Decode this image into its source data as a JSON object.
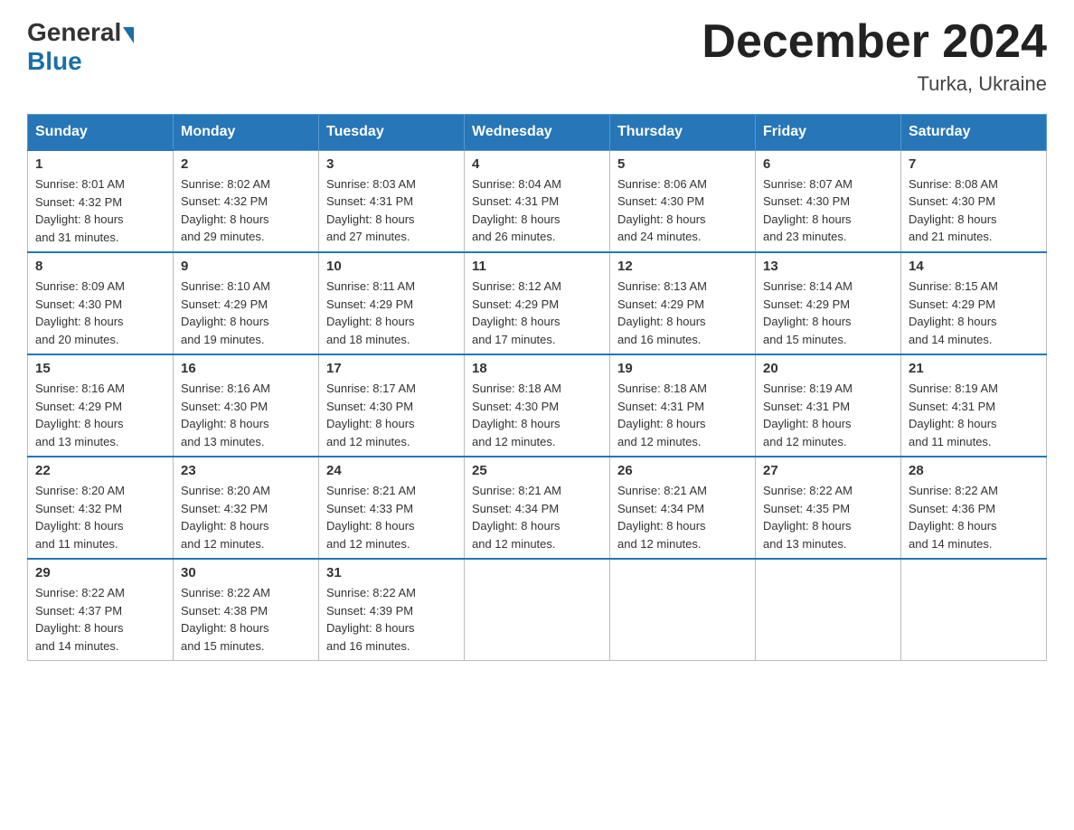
{
  "header": {
    "logo_general": "General",
    "logo_blue": "Blue",
    "month_title": "December 2024",
    "location": "Turka, Ukraine"
  },
  "weekdays": [
    "Sunday",
    "Monday",
    "Tuesday",
    "Wednesday",
    "Thursday",
    "Friday",
    "Saturday"
  ],
  "weeks": [
    [
      {
        "day": "1",
        "sunrise": "8:01 AM",
        "sunset": "4:32 PM",
        "daylight": "8 hours and 31 minutes."
      },
      {
        "day": "2",
        "sunrise": "8:02 AM",
        "sunset": "4:32 PM",
        "daylight": "8 hours and 29 minutes."
      },
      {
        "day": "3",
        "sunrise": "8:03 AM",
        "sunset": "4:31 PM",
        "daylight": "8 hours and 27 minutes."
      },
      {
        "day": "4",
        "sunrise": "8:04 AM",
        "sunset": "4:31 PM",
        "daylight": "8 hours and 26 minutes."
      },
      {
        "day": "5",
        "sunrise": "8:06 AM",
        "sunset": "4:30 PM",
        "daylight": "8 hours and 24 minutes."
      },
      {
        "day": "6",
        "sunrise": "8:07 AM",
        "sunset": "4:30 PM",
        "daylight": "8 hours and 23 minutes."
      },
      {
        "day": "7",
        "sunrise": "8:08 AM",
        "sunset": "4:30 PM",
        "daylight": "8 hours and 21 minutes."
      }
    ],
    [
      {
        "day": "8",
        "sunrise": "8:09 AM",
        "sunset": "4:30 PM",
        "daylight": "8 hours and 20 minutes."
      },
      {
        "day": "9",
        "sunrise": "8:10 AM",
        "sunset": "4:29 PM",
        "daylight": "8 hours and 19 minutes."
      },
      {
        "day": "10",
        "sunrise": "8:11 AM",
        "sunset": "4:29 PM",
        "daylight": "8 hours and 18 minutes."
      },
      {
        "day": "11",
        "sunrise": "8:12 AM",
        "sunset": "4:29 PM",
        "daylight": "8 hours and 17 minutes."
      },
      {
        "day": "12",
        "sunrise": "8:13 AM",
        "sunset": "4:29 PM",
        "daylight": "8 hours and 16 minutes."
      },
      {
        "day": "13",
        "sunrise": "8:14 AM",
        "sunset": "4:29 PM",
        "daylight": "8 hours and 15 minutes."
      },
      {
        "day": "14",
        "sunrise": "8:15 AM",
        "sunset": "4:29 PM",
        "daylight": "8 hours and 14 minutes."
      }
    ],
    [
      {
        "day": "15",
        "sunrise": "8:16 AM",
        "sunset": "4:29 PM",
        "daylight": "8 hours and 13 minutes."
      },
      {
        "day": "16",
        "sunrise": "8:16 AM",
        "sunset": "4:30 PM",
        "daylight": "8 hours and 13 minutes."
      },
      {
        "day": "17",
        "sunrise": "8:17 AM",
        "sunset": "4:30 PM",
        "daylight": "8 hours and 12 minutes."
      },
      {
        "day": "18",
        "sunrise": "8:18 AM",
        "sunset": "4:30 PM",
        "daylight": "8 hours and 12 minutes."
      },
      {
        "day": "19",
        "sunrise": "8:18 AM",
        "sunset": "4:31 PM",
        "daylight": "8 hours and 12 minutes."
      },
      {
        "day": "20",
        "sunrise": "8:19 AM",
        "sunset": "4:31 PM",
        "daylight": "8 hours and 12 minutes."
      },
      {
        "day": "21",
        "sunrise": "8:19 AM",
        "sunset": "4:31 PM",
        "daylight": "8 hours and 11 minutes."
      }
    ],
    [
      {
        "day": "22",
        "sunrise": "8:20 AM",
        "sunset": "4:32 PM",
        "daylight": "8 hours and 11 minutes."
      },
      {
        "day": "23",
        "sunrise": "8:20 AM",
        "sunset": "4:32 PM",
        "daylight": "8 hours and 12 minutes."
      },
      {
        "day": "24",
        "sunrise": "8:21 AM",
        "sunset": "4:33 PM",
        "daylight": "8 hours and 12 minutes."
      },
      {
        "day": "25",
        "sunrise": "8:21 AM",
        "sunset": "4:34 PM",
        "daylight": "8 hours and 12 minutes."
      },
      {
        "day": "26",
        "sunrise": "8:21 AM",
        "sunset": "4:34 PM",
        "daylight": "8 hours and 12 minutes."
      },
      {
        "day": "27",
        "sunrise": "8:22 AM",
        "sunset": "4:35 PM",
        "daylight": "8 hours and 13 minutes."
      },
      {
        "day": "28",
        "sunrise": "8:22 AM",
        "sunset": "4:36 PM",
        "daylight": "8 hours and 14 minutes."
      }
    ],
    [
      {
        "day": "29",
        "sunrise": "8:22 AM",
        "sunset": "4:37 PM",
        "daylight": "8 hours and 14 minutes."
      },
      {
        "day": "30",
        "sunrise": "8:22 AM",
        "sunset": "4:38 PM",
        "daylight": "8 hours and 15 minutes."
      },
      {
        "day": "31",
        "sunrise": "8:22 AM",
        "sunset": "4:39 PM",
        "daylight": "8 hours and 16 minutes."
      },
      null,
      null,
      null,
      null
    ]
  ],
  "labels": {
    "sunrise": "Sunrise:",
    "sunset": "Sunset:",
    "daylight": "Daylight:"
  }
}
